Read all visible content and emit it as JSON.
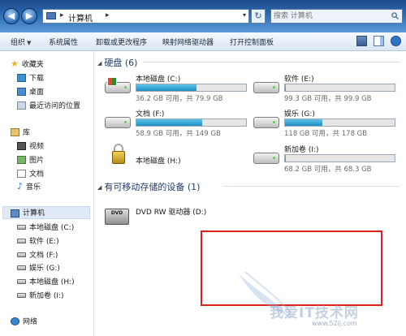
{
  "window": {
    "address": {
      "location": "计算机"
    },
    "search": {
      "placeholder": "搜索 计算机"
    }
  },
  "toolbar": {
    "items": [
      "组织",
      "系统属性",
      "卸载或更改程序",
      "映射网络驱动器",
      "打开控制面板"
    ]
  },
  "sidebar": {
    "favorites": {
      "label": "收藏夹",
      "items": [
        "下载",
        "桌面",
        "最近访问的位置"
      ]
    },
    "libraries": {
      "label": "库",
      "items": [
        "视频",
        "图片",
        "文档",
        "音乐"
      ]
    },
    "computer": {
      "label": "计算机",
      "items": [
        "本地磁盘 (C:)",
        "软件 (E:)",
        "文档 (F:)",
        "娱乐 (G:)",
        "本地磁盘 (H:)",
        "新加卷 (I:)"
      ]
    },
    "network": {
      "label": "网络"
    }
  },
  "content": {
    "hdd_group": "硬盘 (6)",
    "removable_group": "有可移动存储的设备 (1)",
    "drives": [
      {
        "name": "本地磁盘 (C:)",
        "space": "36.2 GB 可用，共 79.9 GB",
        "used_fraction": 0.55
      },
      {
        "name": "软件 (E:)",
        "space": "99.3 GB 可用，共 99.9 GB",
        "used_fraction": 0.01
      },
      {
        "name": "文档 (F:)",
        "space": "58.9 GB 可用，共 149 GB",
        "used_fraction": 0.6
      },
      {
        "name": "娱乐 (G:)",
        "space": "118 GB 可用，共 178 GB",
        "used_fraction": 0.34
      },
      {
        "name": "本地磁盘 (H:)"
      },
      {
        "name": "新加卷 (I:)",
        "space": "68.2 GB 可用，共 68.3 GB",
        "used_fraction": 0.01
      }
    ],
    "dvd": {
      "name": "DVD RW 驱动器 (D:)",
      "icon_text": "DVD"
    }
  },
  "watermark": {
    "text": "我爱IT技术网",
    "url": "www.52ij.com"
  },
  "colors": {
    "accent": "#2b6bb3",
    "bar": "#1c8fc6",
    "highlight": "#e0201d"
  }
}
